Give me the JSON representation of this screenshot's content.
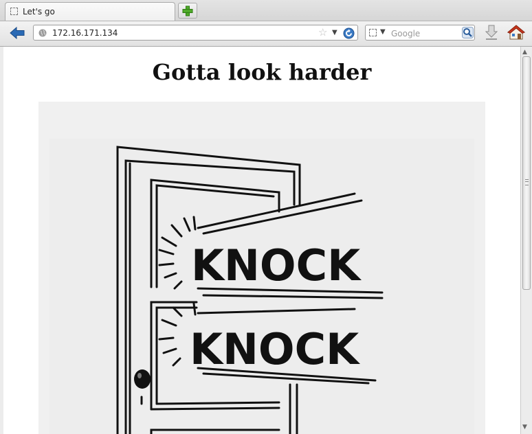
{
  "tab": {
    "title": "Let's go"
  },
  "address_bar": {
    "url": "172.16.171.134"
  },
  "search_bar": {
    "placeholder": "Google"
  },
  "page": {
    "heading": "Gotta look harder",
    "image_text": [
      "KNOCK",
      "KNOCK"
    ]
  },
  "icons": {
    "favicon": "blank-page-icon",
    "new_tab": "plus-icon",
    "back": "back-arrow-icon",
    "site_identity": "globe-icon",
    "bookmark": "star-icon",
    "history": "chevron-down-icon",
    "reload": "reload-icon",
    "search_engine": "search-engine-icon",
    "search_go": "magnifier-icon",
    "downloads": "download-arrow-icon",
    "home": "home-icon"
  },
  "colors": {
    "accent": "#2a6ab5",
    "newtab_plus": "#4faa2a",
    "home_roof": "#c8351c"
  }
}
